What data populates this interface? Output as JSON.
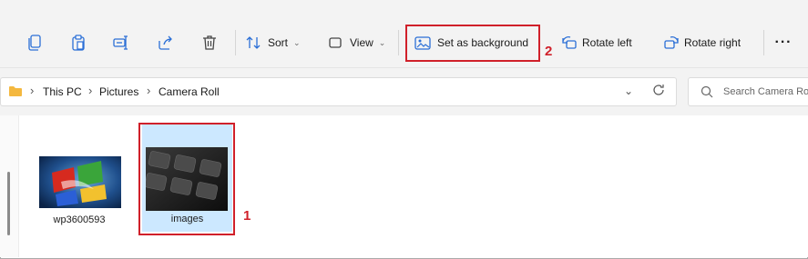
{
  "toolbar": {
    "sort_label": "Sort",
    "view_label": "View",
    "set_background_label": "Set as background",
    "rotate_left_label": "Rotate left",
    "rotate_right_label": "Rotate right",
    "more_label": "···"
  },
  "address": {
    "crumbs": [
      "This PC",
      "Pictures",
      "Camera Roll"
    ],
    "search_placeholder": "Search Camera Ro"
  },
  "files": [
    {
      "name": "wp3600593",
      "selected": false
    },
    {
      "name": "images",
      "selected": true
    }
  ],
  "callouts": {
    "file": "1",
    "toolbar": "2"
  },
  "colors": {
    "callout": "#d0202a",
    "selection": "#cce8ff",
    "folder": "#f4b83f",
    "accent": "#2b6fd6"
  }
}
